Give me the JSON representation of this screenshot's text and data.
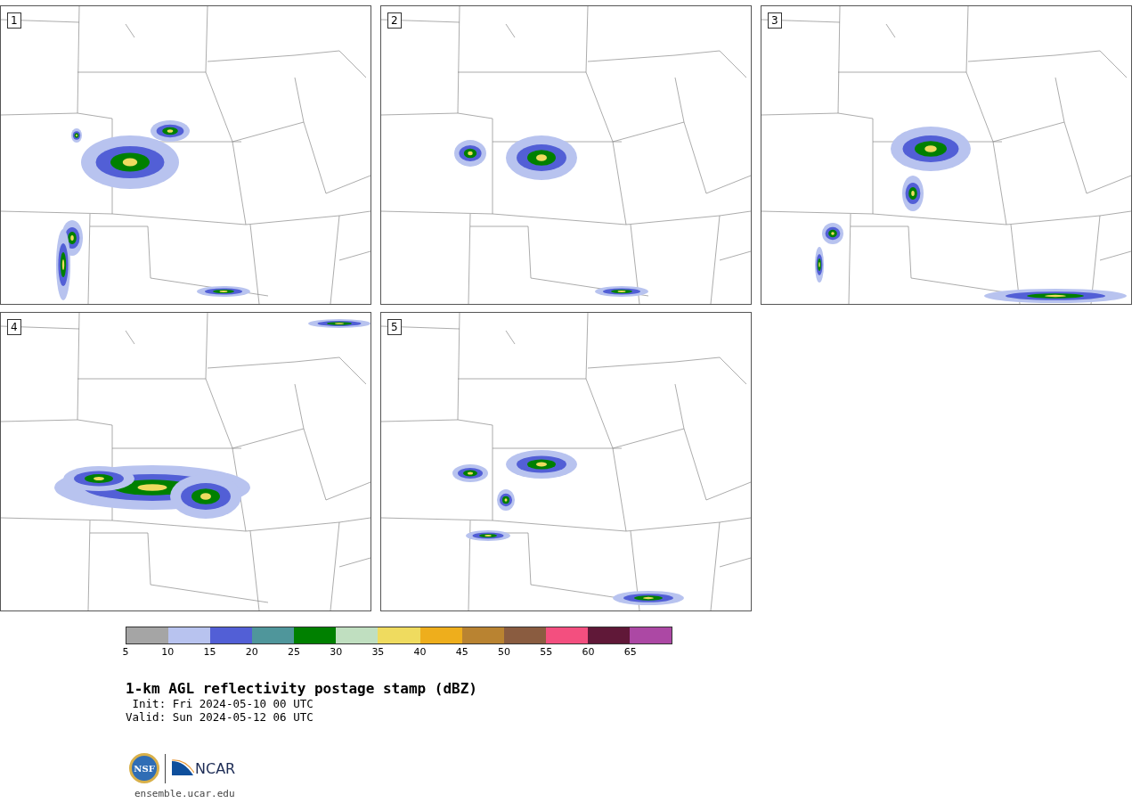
{
  "panels": [
    {
      "label": "1"
    },
    {
      "label": "2"
    },
    {
      "label": "3"
    },
    {
      "label": "4"
    },
    {
      "label": "5"
    }
  ],
  "colorbar": {
    "segments": [
      {
        "color": "#a5a5a5"
      },
      {
        "color": "#b8c3ef"
      },
      {
        "color": "#525fd6"
      },
      {
        "color": "#4f969b"
      },
      {
        "color": "#008000"
      },
      {
        "color": "#c0dfc0"
      },
      {
        "color": "#efdb5f"
      },
      {
        "color": "#eeae1c"
      },
      {
        "color": "#b98331"
      },
      {
        "color": "#8a5c40"
      },
      {
        "color": "#f34f7f"
      },
      {
        "color": "#601838"
      },
      {
        "color": "#ac48a4"
      }
    ],
    "ticks": [
      "5",
      "10",
      "15",
      "20",
      "25",
      "30",
      "35",
      "40",
      "45",
      "50",
      "55",
      "60",
      "65"
    ]
  },
  "title": "1-km AGL reflectivity postage stamp (dBZ)",
  "init": " Init: Fri 2024-05-10 00 UTC",
  "valid": "Valid: Sun 2024-05-12 06 UTC",
  "logos": {
    "nsf": "NSF",
    "ncar": "NCAR"
  },
  "url": "ensemble.ucar.edu"
}
